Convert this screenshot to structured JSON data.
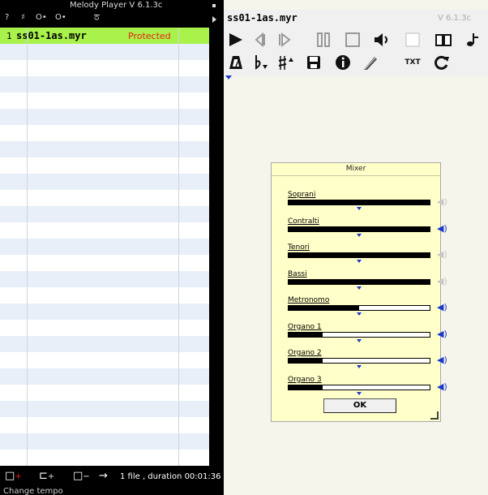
{
  "left_panel": {
    "app_title": "Melody Player V 6.1.3c",
    "top_glyphs": [
      "?",
      "♯",
      "O•",
      "O•",
      "ਠ"
    ],
    "playlist": [
      {
        "number": "1",
        "name": "ss01-1as.myr",
        "status": "Protected",
        "selected": true
      }
    ],
    "footer": {
      "file_info": "1 file , duration 00:01:36",
      "status_text": "Change tempo",
      "icons": [
        "add-file-icon",
        "add-folder-icon",
        "remove-file-icon",
        "arrow-right-icon"
      ]
    }
  },
  "player": {
    "song_title": "ss01-1as.myr",
    "version_label": "V 6.1.3c",
    "toolbar_row1": [
      "play-icon",
      "previous-icon",
      "next-icon",
      "pause-icon",
      "stop-icon",
      "volume-icon",
      "blank-icon",
      "book-icon",
      "note-icon"
    ],
    "toolbar_row2": [
      "metronome-icon",
      "transpose-down-icon",
      "transpose-up-icon",
      "save-icon",
      "info-icon",
      "pen-icon",
      "text-icon",
      "refresh-icon"
    ],
    "text_button_label": "TXT"
  },
  "mixer": {
    "title": "Mixer",
    "ok_label": "OK",
    "channels": [
      {
        "name": "Soprani",
        "level": 1.0,
        "muted": true
      },
      {
        "name": "Contralti",
        "level": 1.0,
        "muted": false
      },
      {
        "name": "Tenori",
        "level": 1.0,
        "muted": true
      },
      {
        "name": "Bassi",
        "level": 1.0,
        "muted": true
      },
      {
        "name": "Metronomo",
        "level": 0.5,
        "muted": false
      },
      {
        "name": "Organo 1",
        "level": 0.24,
        "muted": false
      },
      {
        "name": "Organo 2",
        "level": 0.24,
        "muted": false
      },
      {
        "name": "Organo 3",
        "level": 0.24,
        "muted": false
      }
    ]
  },
  "colors": {
    "selected_row": "#a9f24b",
    "protected_text": "#e8220f",
    "knob_blue": "#1b3ac9",
    "mixer_bg": "#ffffc9"
  }
}
